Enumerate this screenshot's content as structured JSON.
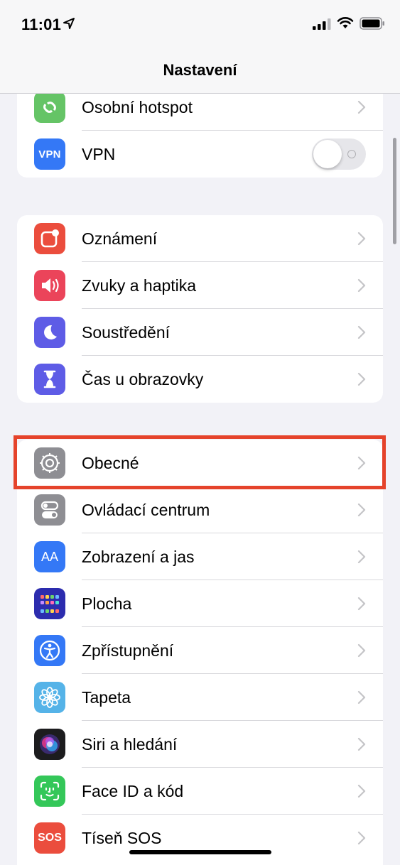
{
  "status_bar": {
    "time": "11:01"
  },
  "nav": {
    "title": "Nastavení"
  },
  "groups": [
    {
      "rows": [
        {
          "label": "Osobní hotspot",
          "icon": "hotspot-icon",
          "color": "#65c466"
        },
        {
          "label": "VPN",
          "icon": "vpn-icon",
          "icon_text": "VPN",
          "color": "#3478f6",
          "toggle": "off"
        }
      ]
    },
    {
      "rows": [
        {
          "label": "Oznámení",
          "icon": "notifications-icon",
          "color": "#eb4d3d"
        },
        {
          "label": "Zvuky a haptika",
          "icon": "sounds-icon",
          "color": "#eb445a"
        },
        {
          "label": "Soustředění",
          "icon": "focus-moon-icon",
          "color": "#5e5ce6"
        },
        {
          "label": "Čas u obrazovky",
          "icon": "screen-time-icon",
          "color": "#5e5ce6"
        }
      ]
    },
    {
      "rows": [
        {
          "label": "Obecné",
          "icon": "gear-icon",
          "color": "#8e8e93",
          "highlighted": true
        },
        {
          "label": "Ovládací centrum",
          "icon": "control-center-icon",
          "color": "#8e8e93"
        },
        {
          "label": "Zobrazení a jas",
          "icon": "display-brightness-icon",
          "icon_text": "AA",
          "color": "#3478f6"
        },
        {
          "label": "Plocha",
          "icon": "home-screen-icon",
          "color": "#2c2cae"
        },
        {
          "label": "Zpřístupnění",
          "icon": "accessibility-icon",
          "color": "#3478f6"
        },
        {
          "label": "Tapeta",
          "icon": "wallpaper-icon",
          "color": "#55b3e8"
        },
        {
          "label": "Siri a hledání",
          "icon": "siri-icon",
          "color": "#1c1c1e"
        },
        {
          "label": "Face ID a kód",
          "icon": "face-id-icon",
          "color": "#34c759"
        },
        {
          "label": "Tíseň SOS",
          "icon": "sos-icon",
          "icon_text": "SOS",
          "color": "#eb4d3d"
        }
      ]
    }
  ],
  "colors": {
    "highlight_box": "#e5432b",
    "background": "#f2f2f7"
  }
}
